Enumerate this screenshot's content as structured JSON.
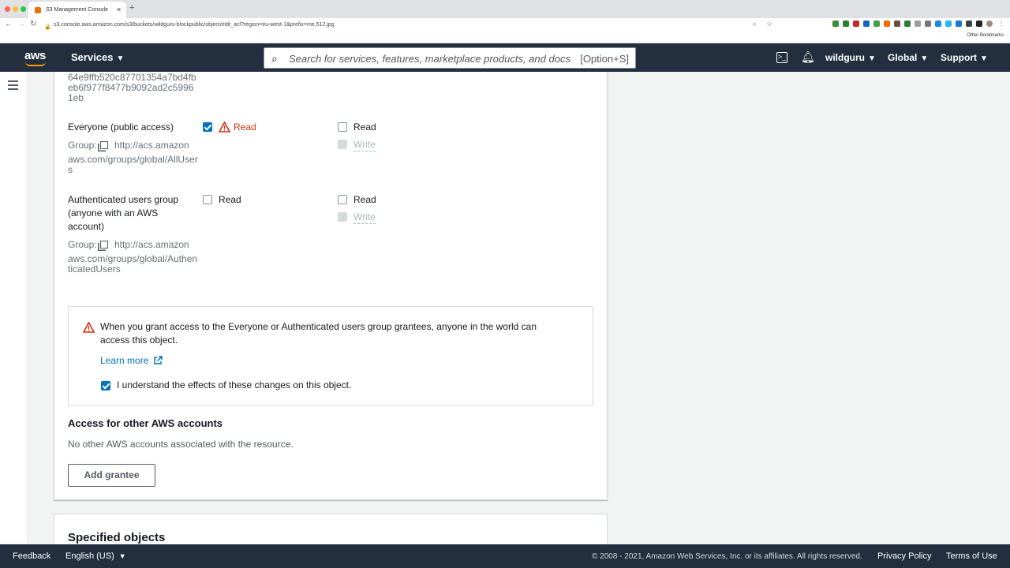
{
  "browser": {
    "tab_title": "S3 Management Console",
    "url": "s3.console.aws.amazon.com/s3/buckets/wildguru-blockpublic/object/edit_acl?region=eu-west-1&prefix=me.512.jpg",
    "bookmarks_label": "Other Bookmarks",
    "traffic_colors": [
      "#ff5f57",
      "#febc2e",
      "#28c840"
    ]
  },
  "aws_nav": {
    "logo_text": "aws",
    "services_label": "Services",
    "search_placeholder": "Search for services, features, marketplace products, and docs",
    "search_shortcut": "[Option+S]",
    "account_label": "wildguru",
    "region_label": "Global",
    "support_label": "Support"
  },
  "acl": {
    "prev_grantee_id": [
      "64e9ffb520c87701354a7bd4fb",
      "eb6f977f8477b9092ad2c5996",
      "1eb"
    ],
    "everyone": {
      "name": "Everyone (public access)",
      "group_label": "Group:",
      "group_uri": [
        "http://acs.amazon",
        "aws.com/groups/global/AllUser",
        "s"
      ],
      "objects_read": "Read",
      "objects_read_checked": true,
      "acl_read": "Read",
      "acl_write": "Write"
    },
    "authenticated": {
      "name": [
        "Authenticated users group",
        "(anyone with an AWS",
        "account)"
      ],
      "group_label": "Group:",
      "group_uri": [
        "http://acs.amazon",
        "aws.com/groups/global/Authen",
        "ticatedUsers"
      ],
      "objects_read": "Read",
      "acl_read": "Read",
      "acl_write": "Write"
    }
  },
  "alert": {
    "message_line1": "When you grant access to the Everyone or Authenticated users group grantees, anyone in the world can",
    "message_line2": "access this object.",
    "learn_more": "Learn more",
    "acknowledge_label": "I understand the effects of these changes on this object.",
    "acknowledge_checked": true,
    "warning_color": "#d13212"
  },
  "other_accounts": {
    "heading": "Access for other AWS accounts",
    "empty_text": "No other AWS accounts associated with the resource.",
    "add_button": "Add grantee"
  },
  "specified_objects": {
    "heading": "Specified objects"
  },
  "footer": {
    "feedback": "Feedback",
    "language": "English (US)",
    "copyright": "© 2008 - 2021, Amazon Web Services, Inc. or its affiliates. All rights reserved.",
    "privacy": "Privacy Policy",
    "terms": "Terms of Use"
  }
}
